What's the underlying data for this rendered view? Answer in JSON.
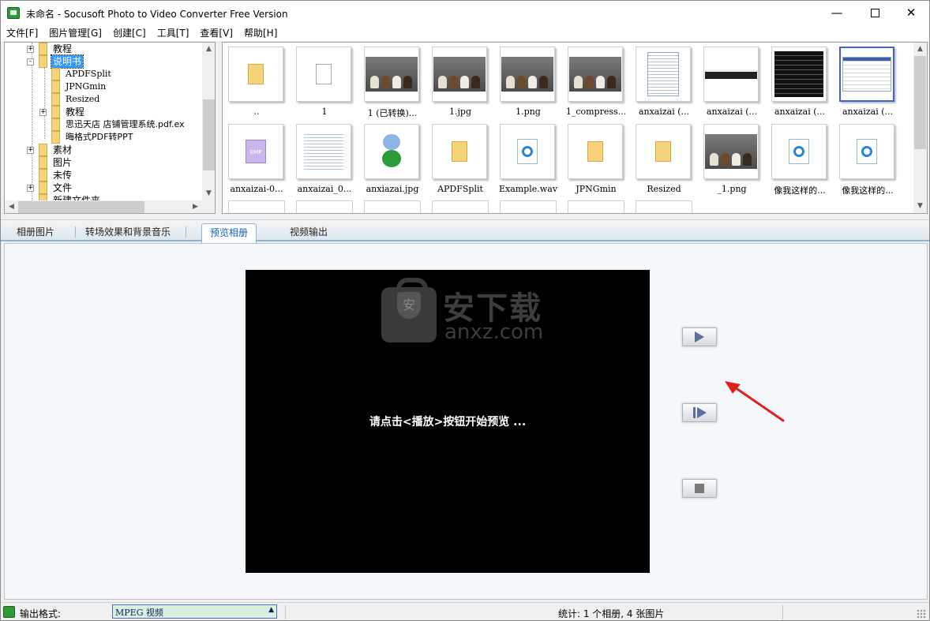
{
  "window": {
    "title": "未命名 - Socusoft Photo to Video Converter Free Version",
    "controls": {
      "minimize": "—",
      "maximize": "",
      "close": "✕"
    }
  },
  "menu": [
    "文件[F]",
    "图片管理[G]",
    "创建[C]",
    "工具[T]",
    "查看[V]",
    "帮助[H]"
  ],
  "tree": {
    "items": [
      {
        "label": "教程",
        "level": 0,
        "expander": "+",
        "selected": false
      },
      {
        "label": "说明书",
        "level": 0,
        "expander": "-",
        "selected": true
      },
      {
        "label": "APDFSplit",
        "level": 1,
        "expander": "",
        "selected": false
      },
      {
        "label": "JPNGmin",
        "level": 1,
        "expander": "",
        "selected": false
      },
      {
        "label": "Resized",
        "level": 1,
        "expander": "",
        "selected": false
      },
      {
        "label": "教程",
        "level": 1,
        "expander": "+",
        "selected": false
      },
      {
        "label": "思迅天店 店铺管理系统.pdf.ex",
        "level": 1,
        "expander": "",
        "selected": false
      },
      {
        "label": "晦格式PDF转PPT",
        "level": 1,
        "expander": "",
        "selected": false
      },
      {
        "label": "素材",
        "level": 0,
        "expander": "+",
        "selected": false
      },
      {
        "label": "图片",
        "level": 0,
        "expander": "",
        "selected": false
      },
      {
        "label": "未传",
        "level": 0,
        "expander": "",
        "selected": false
      },
      {
        "label": "文件",
        "level": 0,
        "expander": "+",
        "selected": false
      },
      {
        "label": "新建文件夹",
        "level": 0,
        "expander": "",
        "selected": false
      }
    ]
  },
  "thumbnails": [
    {
      "label": "..",
      "kind": "folder"
    },
    {
      "label": "1",
      "kind": "file"
    },
    {
      "label": "1 (已转换)...",
      "kind": "dogs"
    },
    {
      "label": "1.jpg",
      "kind": "dogs"
    },
    {
      "label": "1.png",
      "kind": "dogs"
    },
    {
      "label": "1_compress...",
      "kind": "dogs"
    },
    {
      "label": "anxaizai (...",
      "kind": "doc"
    },
    {
      "label": "anxaizai (...",
      "kind": "strip"
    },
    {
      "label": "anxaizai (...",
      "kind": "dark"
    },
    {
      "label": "anxaizai (...",
      "kind": "shot",
      "selected": true
    },
    {
      "label": "anxaizai-0...",
      "kind": "bmp"
    },
    {
      "label": "anxaizai_0...",
      "kind": "doc"
    },
    {
      "label": "anxiazai.jpg",
      "kind": "char"
    },
    {
      "label": "APDFSplit",
      "kind": "folder"
    },
    {
      "label": "Example.wav",
      "kind": "media"
    },
    {
      "label": "JPNGmin",
      "kind": "folder"
    },
    {
      "label": "Resized",
      "kind": "folder"
    },
    {
      "label": "_1.png",
      "kind": "dogs"
    },
    {
      "label": "像我这样的...",
      "kind": "media"
    },
    {
      "label": "像我这样的...",
      "kind": "media"
    }
  ],
  "tabs": [
    {
      "label": "相册图片",
      "active": false
    },
    {
      "label": "转场效果和背景音乐",
      "active": false
    },
    {
      "label": "预览相册",
      "active": true
    },
    {
      "label": "视频输出",
      "active": false
    }
  ],
  "preview": {
    "watermark_cn": "安下载",
    "watermark_en": "anxz.com",
    "watermark_shield": "安",
    "message": "请点击<播放>按钮开始预览 ..."
  },
  "status": {
    "format_label": "输出格式:",
    "format_value": "MPEG 视频",
    "format_arrow": "▲",
    "stats": "统计: 1 个相册, 4 张图片"
  },
  "colors": {
    "selection": "#3399ff",
    "active_tab_text": "#1560b8",
    "arrow_annotation": "#e0201f",
    "format_select_bg": "#d9f0e0"
  }
}
